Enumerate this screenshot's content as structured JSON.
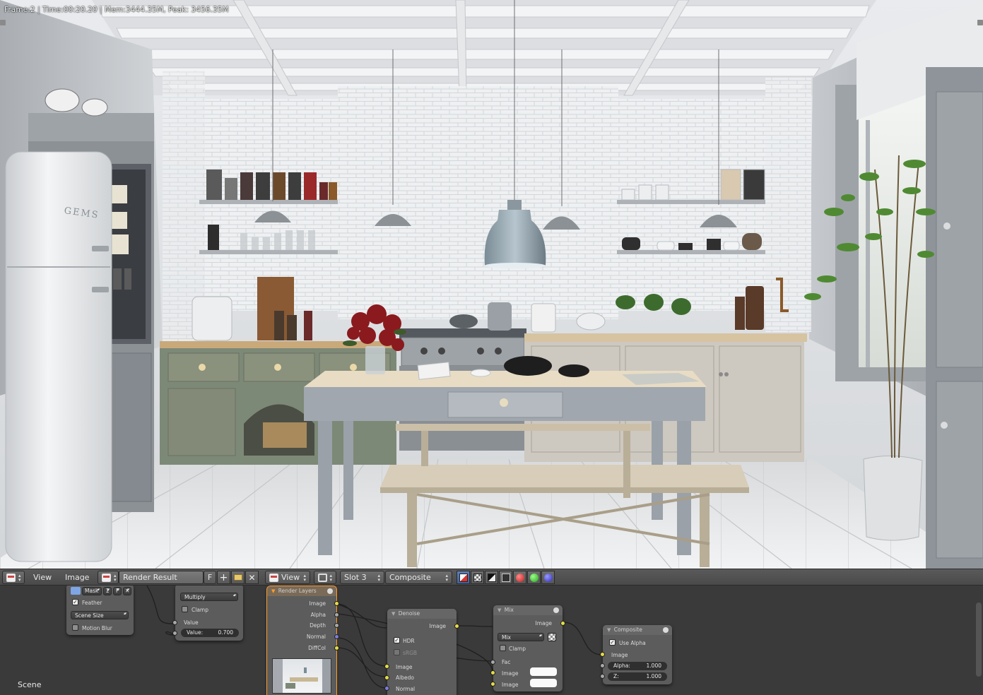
{
  "render": {
    "status": "Frame:2 | Time:00:20.20 | Mem:3444.35M, Peak: 3456.35M",
    "brand_text": "GEMS"
  },
  "header": {
    "menus": {
      "view": "View",
      "image": "Image"
    },
    "image_name": "Render Result",
    "fake_user": "F",
    "view_mode": "View",
    "slot": "Slot 3",
    "layer": "Composite"
  },
  "nodes": {
    "mask": {
      "label": "Mask",
      "users": "2",
      "fake": "F",
      "feather": "Feather",
      "size": "Scene Size",
      "motion_blur": "Motion Blur"
    },
    "math": {
      "operation": "Multiply",
      "clamp": "Clamp",
      "value_label": "Value",
      "field_label": "Value:",
      "field_value": "0.700"
    },
    "render_layers": {
      "title": "Render Layers",
      "outputs": [
        "Image",
        "Alpha",
        "Depth",
        "Normal",
        "DiffCol"
      ]
    },
    "denoise": {
      "title": "Denoise",
      "out": "Image",
      "hdr": "HDR",
      "srgb": "sRGB",
      "inputs": [
        "Image",
        "Albedo",
        "Normal"
      ]
    },
    "mix": {
      "title": "Mix",
      "out": "Image",
      "mode": "Mix",
      "clamp": "Clamp",
      "fac": "Fac",
      "img1": "Image",
      "img2": "Image"
    },
    "composite": {
      "title": "Composite",
      "use_alpha": "Use Alpha",
      "image": "Image",
      "alpha_label": "Alpha:",
      "alpha_value": "1.000",
      "z_label": "Z:",
      "z_value": "1.000"
    }
  },
  "footer": {
    "scene": "Scene"
  },
  "colors": {
    "node_bg": "#5c5c5c",
    "editor_bg": "#3a3a3a",
    "socket_image": "#e6dc46",
    "socket_value": "#a8a8a8",
    "socket_vector": "#7c7ce0",
    "active_outline": "#ff9d2b"
  }
}
